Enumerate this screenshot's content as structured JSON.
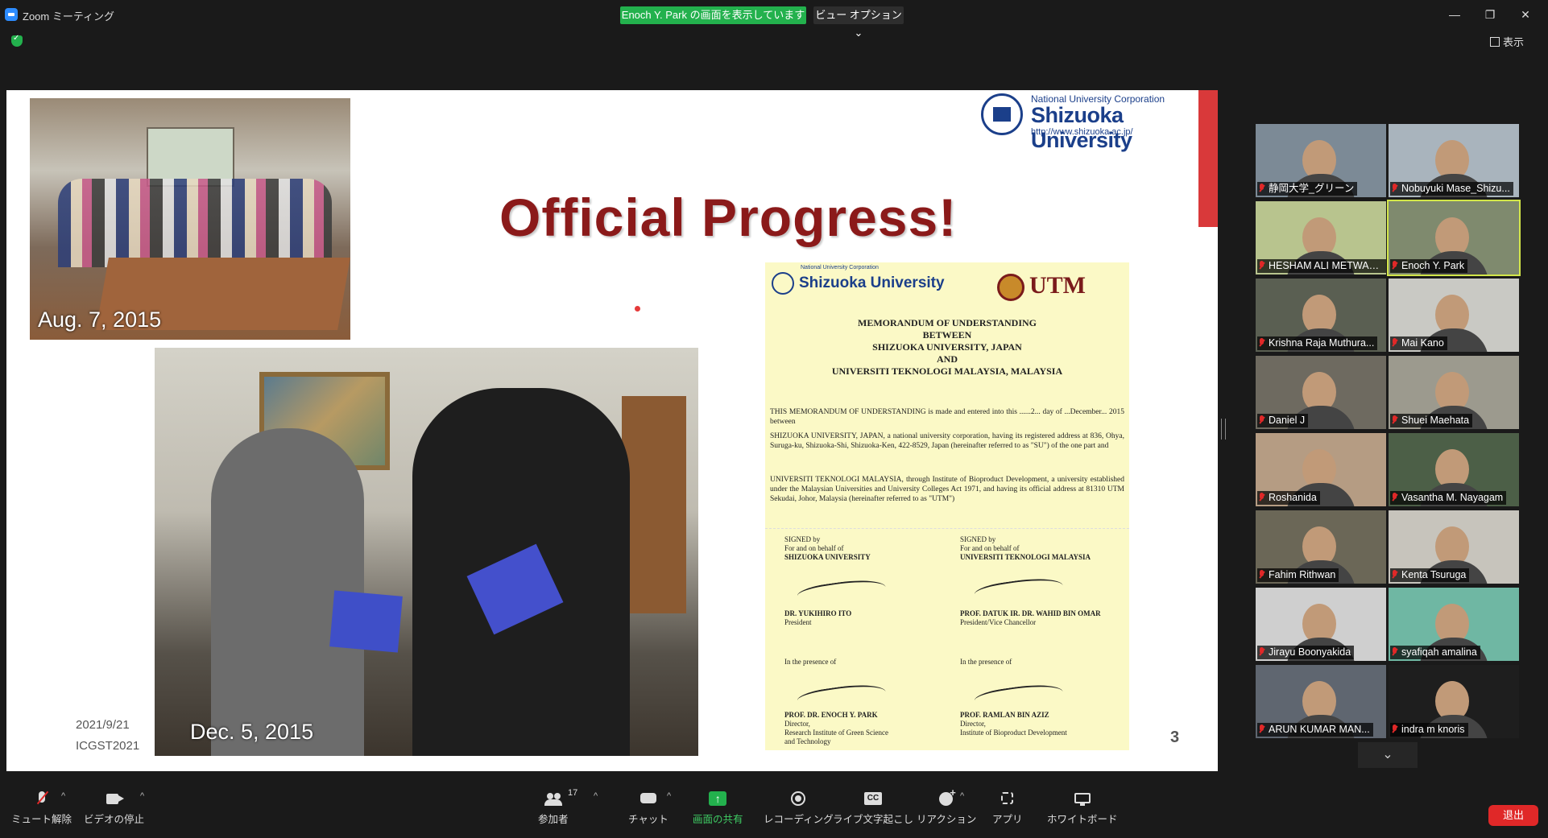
{
  "window": {
    "title": "Zoom ミーティング",
    "share_banner": "Enoch Y. Park の画面を表示しています",
    "view_options": "ビュー オプション ⌄",
    "view_toggle": "表示",
    "controls": {
      "minimize": "—",
      "maximize": "❐",
      "close": "✕"
    }
  },
  "slide": {
    "title": "Official Progress!",
    "university_logo": {
      "small": "National University Corporation",
      "name": "Shizuoka University",
      "url": "http://www.shizuoka.ac.jp/"
    },
    "photo_top_label": "Aug. 7, 2015",
    "photo_bottom_label": "Dec. 5, 2015",
    "date": "2021/9/21",
    "conference": "ICGST2021",
    "page_number": "3",
    "mou": {
      "su_small": "National University Corporation",
      "su_name": "Shizuoka University",
      "utm": "UTM",
      "heading": [
        "MEMORANDUM OF UNDERSTANDING",
        "BETWEEN",
        "SHIZUOKA UNIVERSITY, JAPAN",
        "AND",
        "UNIVERSITI TEKNOLOGI MALAYSIA, MALAYSIA"
      ],
      "para1": "THIS MEMORANDUM OF UNDERSTANDING is made and entered into this ......2... day of ...December... 2015 between",
      "para2": "SHIZUOKA UNIVERSITY, JAPAN, a national university corporation, having its registered address at 836, Ohya, Suruga-ku, Shizuoka-Shi, Shizuoka-Ken, 422-8529, Japan (hereinafter referred to as \"SU\") of the one part and",
      "para3": "UNIVERSITI TEKNOLOGI MALAYSIA, through Institute of Bioproduct Development, a university established under the Malaysian Universities and University Colleges Act 1971, and having its official address at 81310 UTM Sekudai, Johor, Malaysia (hereinafter referred to as \"UTM\")",
      "left_sign": {
        "signed_by": "SIGNED by",
        "behalf": "For and on behalf of",
        "org": "SHIZUOKA UNIVERSITY",
        "name": "DR. YUKIHIRO ITO",
        "role": "President"
      },
      "right_sign": {
        "signed_by": "SIGNED by",
        "behalf": "For and on behalf of",
        "org": "UNIVERSITI TEKNOLOGI MALAYSIA",
        "name": "PROF. DATUK IR. DR. WAHID BIN OMAR",
        "role": "President/Vice Chancellor"
      },
      "left_witness": {
        "presence": "In the presence of",
        "name": "PROF. DR. ENOCH Y. PARK",
        "role1": "Director,",
        "role2": "Research Institute of Green Science",
        "role3": "and Technology"
      },
      "right_witness": {
        "presence": "In the presence of",
        "name": "PROF. RAMLAN BIN AZIZ",
        "role1": "Director,",
        "role2": "Institute of Bioproduct Development"
      }
    }
  },
  "participants": [
    {
      "name": "静岡大学_グリーン",
      "bg": "#7c8a96"
    },
    {
      "name": "Nobuyuki Mase_Shizu...",
      "bg": "#a9b4bd"
    },
    {
      "name": "HESHAM ALI METWALLY ...",
      "bg": "#b8c48e"
    },
    {
      "name": "Enoch Y. Park",
      "bg": "#7f8a6e"
    },
    {
      "name": "Krishna Raja Muthura...",
      "bg": "#5a5f52"
    },
    {
      "name": "Mai Kano",
      "bg": "#c9c9c4"
    },
    {
      "name": "Daniel J",
      "bg": "#6e6a60"
    },
    {
      "name": "Shuei Maehata",
      "bg": "#9c9a8e"
    },
    {
      "name": "Roshanida",
      "bg": "#b59c83"
    },
    {
      "name": "Vasantha M. Nayagam",
      "bg": "#4c5f47"
    },
    {
      "name": "Fahim Rithwan",
      "bg": "#6b6757"
    },
    {
      "name": "Kenta Tsuruga",
      "bg": "#c7c4bc"
    },
    {
      "name": "Jirayu Boonyakida",
      "bg": "#cfcfcf"
    },
    {
      "name": "syafiqah amalina",
      "bg": "#6fb7a3"
    },
    {
      "name": "ARUN KUMAR MAN...",
      "bg": "#5f6670"
    },
    {
      "name": "indra m knoris",
      "bg": "#1e1e1e"
    }
  ],
  "toolbar": {
    "mute": "ミュート解除",
    "video": "ビデオの停止",
    "participants": "参加者",
    "participant_count": "17",
    "chat": "チャット",
    "share": "画面の共有",
    "record": "レコーディング",
    "captions": "ライブ文字起こし",
    "reactions": "リアクション",
    "apps": "アプリ",
    "whiteboard": "ホワイトボード",
    "leave": "退出"
  }
}
